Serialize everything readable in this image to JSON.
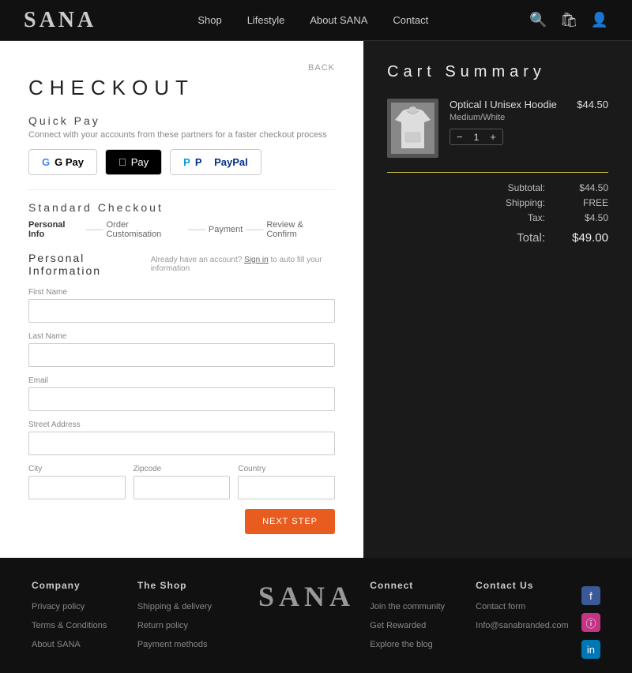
{
  "nav": {
    "logo": "SANA",
    "links": [
      {
        "label": "Shop",
        "href": "#"
      },
      {
        "label": "Lifestyle",
        "href": "#"
      },
      {
        "label": "About SANA",
        "href": "#"
      },
      {
        "label": "Contact",
        "href": "#"
      }
    ]
  },
  "checkout": {
    "back_label": "BACK",
    "title": "CHECKOUT",
    "quick_pay_title": "Quick Pay",
    "quick_pay_desc": "Connect with your accounts from these partners for a faster checkout process",
    "gpay_label": "G Pay",
    "applepay_label": "Pay",
    "paypal_label": "PayPal",
    "standard_title": "Standard Checkout",
    "steps": {
      "step1": "Personal Info",
      "step2": "Order Customisation",
      "step3": "Payment",
      "step4": "Review & Confirm"
    },
    "personal_info_title": "Personal Information",
    "signin_hint": "Already have an account?",
    "signin_link": "Sign in",
    "signin_hint2": "to auto fill your information",
    "fields": {
      "first_name_label": "First Name",
      "last_name_label": "Last Name",
      "email_label": "Email",
      "street_label": "Street Address",
      "city_label": "City",
      "zipcode_label": "Zipcode",
      "country_label": "Country"
    },
    "next_btn": "NEXT STEP"
  },
  "cart": {
    "title": "Cart Summary",
    "item": {
      "name": "Optical I Unisex Hoodie",
      "variant": "Medium/White",
      "quantity": 1,
      "price": "$44.50"
    },
    "subtotal_label": "Subtotal:",
    "subtotal_value": "$44.50",
    "shipping_label": "Shipping:",
    "shipping_value": "FREE",
    "tax_label": "Tax:",
    "tax_value": "$4.50",
    "total_label": "Total:",
    "total_value": "$49.00"
  },
  "footer": {
    "company_title": "Company",
    "company_links": [
      {
        "label": "Privacy policy"
      },
      {
        "label": "Terms & Conditions"
      },
      {
        "label": "About SANA"
      }
    ],
    "shop_title": "The Shop",
    "shop_links": [
      {
        "label": "Shipping & delivery"
      },
      {
        "label": "Return policy"
      },
      {
        "label": "Payment methods"
      }
    ],
    "logo": "SANA",
    "connect_title": "Connect",
    "connect_links": [
      {
        "label": "Join the community"
      },
      {
        "label": "Get Rewarded"
      },
      {
        "label": "Explore the blog"
      }
    ],
    "contact_title": "Contact Us",
    "contact_links": [
      {
        "label": "Contact form"
      },
      {
        "label": "Info@sanabranded.com"
      }
    ]
  }
}
